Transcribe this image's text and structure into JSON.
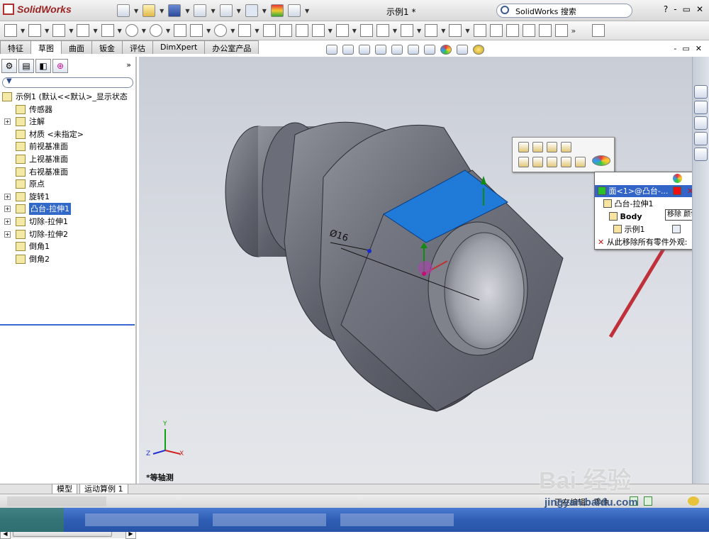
{
  "app": {
    "name": "SolidWorks",
    "document_title": "示例1 *",
    "search_placeholder": "SolidWorks 搜索"
  },
  "window_buttons": [
    "?",
    "-",
    "▭",
    "✕"
  ],
  "tabs": [
    {
      "label": "特征"
    },
    {
      "label": "草图",
      "active": true
    },
    {
      "label": "曲面"
    },
    {
      "label": "钣金"
    },
    {
      "label": "评估"
    },
    {
      "label": "DimXpert"
    },
    {
      "label": "办公室产品"
    }
  ],
  "panel": {
    "chevron": "»",
    "tree": [
      {
        "label": "示例1  (默认<<默认>_显示状态",
        "icon": "part-icon",
        "root": true
      },
      {
        "label": "传感器",
        "icon": "sensor-icon"
      },
      {
        "label": "注解",
        "icon": "annotation-icon",
        "expandable": true
      },
      {
        "label": "材质 <未指定>",
        "icon": "material-icon"
      },
      {
        "label": "前视基准面",
        "icon": "plane-icon"
      },
      {
        "label": "上视基准面",
        "icon": "plane-icon"
      },
      {
        "label": "右视基准面",
        "icon": "plane-icon"
      },
      {
        "label": "原点",
        "icon": "origin-icon"
      },
      {
        "label": "旋转1",
        "icon": "revolve-icon",
        "expandable": true
      },
      {
        "label": "凸台-拉伸1",
        "icon": "extrude-icon",
        "expandable": true,
        "selected": true
      },
      {
        "label": "切除-拉伸1",
        "icon": "cut-extrude-icon",
        "expandable": true
      },
      {
        "label": "切除-拉伸2",
        "icon": "cut-extrude-icon",
        "expandable": true
      },
      {
        "label": "倒角1",
        "icon": "chamfer-icon"
      },
      {
        "label": "倒角2",
        "icon": "chamfer-icon"
      }
    ]
  },
  "viewport": {
    "dimension": "Ø16",
    "view_name": "*等轴测",
    "triad": {
      "x": "X",
      "y": "Y",
      "z": "Z"
    }
  },
  "appearance_menu": {
    "rows": [
      {
        "label": "面<1>@凸台-...",
        "selected": true
      },
      {
        "label": "凸台-拉伸1"
      },
      {
        "label": "Body"
      },
      {
        "label": "示例1"
      },
      {
        "label": "从此移除所有零件外观:"
      }
    ],
    "tooltip": "移除 颜色"
  },
  "bottom_tabs": [
    "模型",
    "运动算例 1"
  ],
  "status": {
    "text": "正在编辑：零件"
  },
  "watermark": {
    "brand": "Bai 经验",
    "url": "jingyan.baidu.com"
  },
  "colors": {
    "accent": "#3268c8",
    "face_highlight": "#1f7ad8",
    "arrow": "#c0303a",
    "model": "#6b6e78"
  }
}
